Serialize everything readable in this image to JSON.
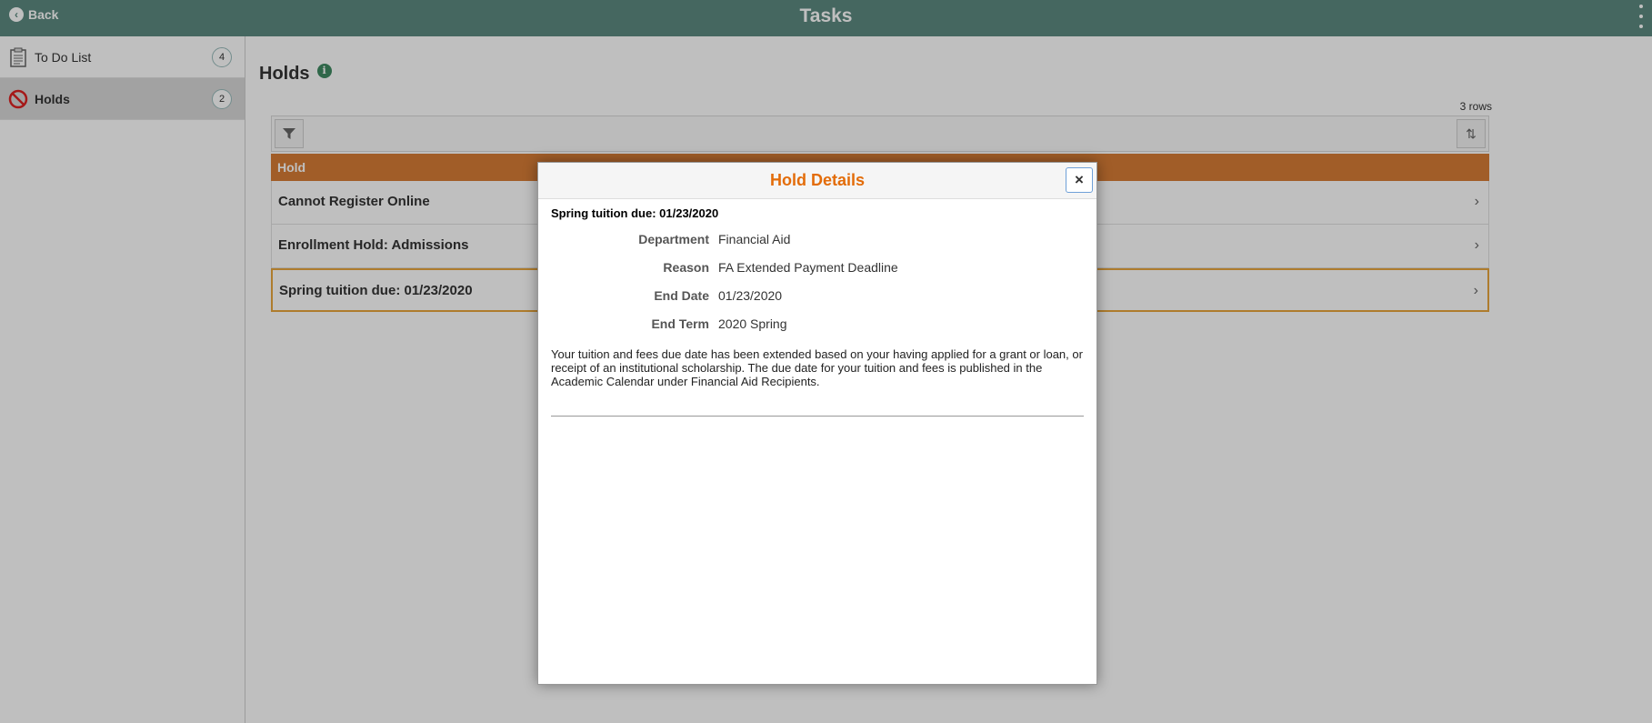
{
  "header": {
    "back_label": "Back",
    "title": "Tasks"
  },
  "sidebar": {
    "items": [
      {
        "label": "To Do List",
        "badge": "4",
        "icon": "clipboard-icon"
      },
      {
        "label": "Holds",
        "badge": "2",
        "icon": "prohibited-icon"
      }
    ]
  },
  "main": {
    "title": "Holds",
    "info_icon": "info-icon",
    "rows_count": "3 rows",
    "grid": {
      "header": "Hold",
      "rows": [
        "Cannot Register Online",
        "Enrollment Hold: Admissions",
        "Spring tuition due: 01/23/2020"
      ]
    }
  },
  "modal": {
    "title": "Hold Details",
    "close_label": "×",
    "heading": "Spring tuition due: 01/23/2020",
    "details": [
      {
        "label": "Department",
        "value": "Financial Aid"
      },
      {
        "label": "Reason",
        "value": "FA Extended Payment Deadline"
      },
      {
        "label": "End Date",
        "value": "01/23/2020"
      },
      {
        "label": "End Term",
        "value": "2020 Spring"
      }
    ],
    "description": "Your tuition and fees due date has been extended based on your having applied for a grant or loan, or receipt of an institutional scholarship. The due date for your tuition and fees is published in the Academic Calendar under Financial Aid Recipients."
  },
  "colors": {
    "header_bg": "#5d8a80",
    "grid_header_bg": "#d77d36",
    "modal_title": "#e36c09",
    "selected_border": "#e8a63c"
  }
}
